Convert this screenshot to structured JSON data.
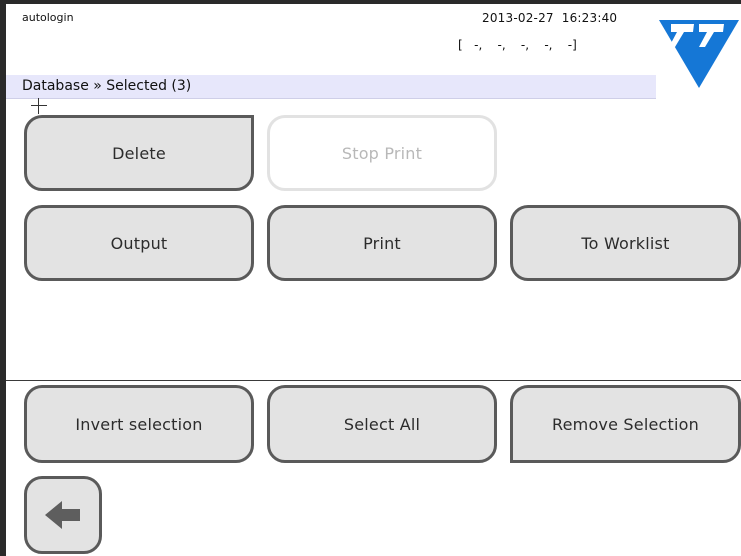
{
  "status_bar": {
    "user": "autologin",
    "datetime": "2013-02-27  16:23:40",
    "indicators": "[   -,    -,    -,    -,    -]"
  },
  "breadcrumb": {
    "text": "Database » Selected (3)"
  },
  "buttons": {
    "delete": "Delete",
    "stop_print": "Stop Print",
    "output": "Output",
    "print": "Print",
    "to_worklist": "To Worklist",
    "invert_selection": "Invert selection",
    "select_all": "Select All",
    "remove_selection": "Remove Selection"
  },
  "icons": {
    "logo": "77-triangle-logo",
    "back": "arrow-left-icon"
  },
  "colors": {
    "logo_blue": "#1577d6",
    "breadcrumb_bg": "#e7e7fb",
    "button_bg": "#e3e3e3",
    "button_border": "#5a5a5a"
  }
}
